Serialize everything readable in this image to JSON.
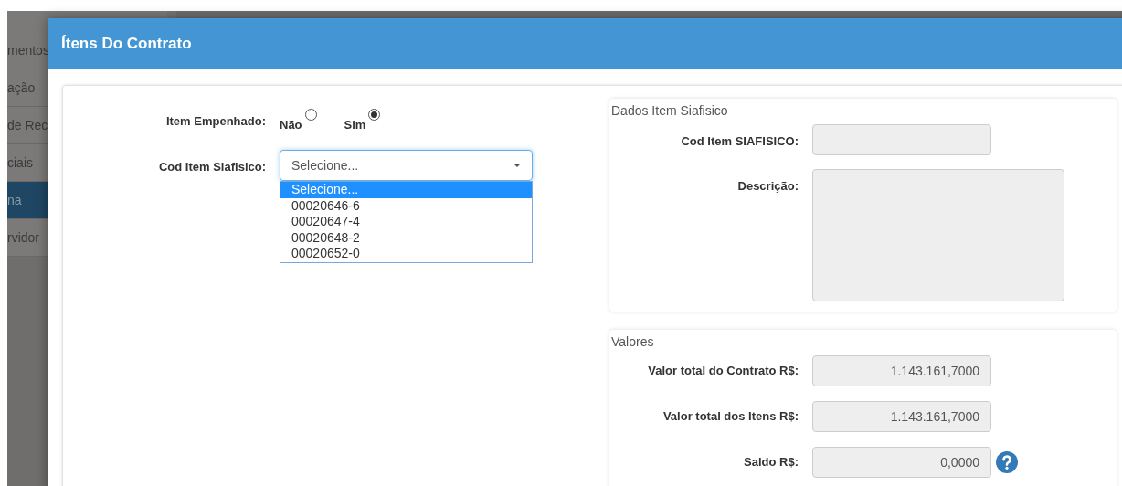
{
  "sidebar": {
    "items": [
      {
        "label": "mentos",
        "selected": false
      },
      {
        "label": "ação",
        "selected": false
      },
      {
        "label": "de Rec",
        "selected": false
      },
      {
        "label": "ciais",
        "selected": false
      },
      {
        "label": "na",
        "selected": true
      },
      {
        "label": "rvidor",
        "selected": false
      }
    ]
  },
  "modal": {
    "title": "Ítens Do Contrato"
  },
  "form": {
    "item_empenhado": {
      "label": "Item Empenhado:",
      "options": [
        {
          "label": "Não",
          "selected": false
        },
        {
          "label": "Sim",
          "selected": true
        }
      ]
    },
    "cod_item": {
      "label": "Cod Item Siafisico:",
      "value": "Selecione...",
      "expanded": true,
      "options": [
        {
          "label": "Selecione...",
          "selected": true
        },
        {
          "label": "00020646-6",
          "selected": false
        },
        {
          "label": "00020647-4",
          "selected": false
        },
        {
          "label": "00020648-2",
          "selected": false
        },
        {
          "label": "00020652-0",
          "selected": false
        }
      ]
    }
  },
  "dados_panel": {
    "title": "Dados Item Siafisico",
    "fields": [
      {
        "label": "Cod Item SIAFISICO:",
        "kind": "input"
      },
      {
        "label": "Descrição:",
        "kind": "textarea"
      }
    ]
  },
  "valores_panel": {
    "title": "Valores",
    "fields": [
      {
        "label": "Valor total do Contrato R$:",
        "value": "1.143.161,7000",
        "help": false
      },
      {
        "label": "Valor total dos Itens R$:",
        "value": "1.143.161,7000",
        "help": false
      },
      {
        "label": "Saldo R$:",
        "value": "0,0000",
        "help": true
      }
    ]
  }
}
